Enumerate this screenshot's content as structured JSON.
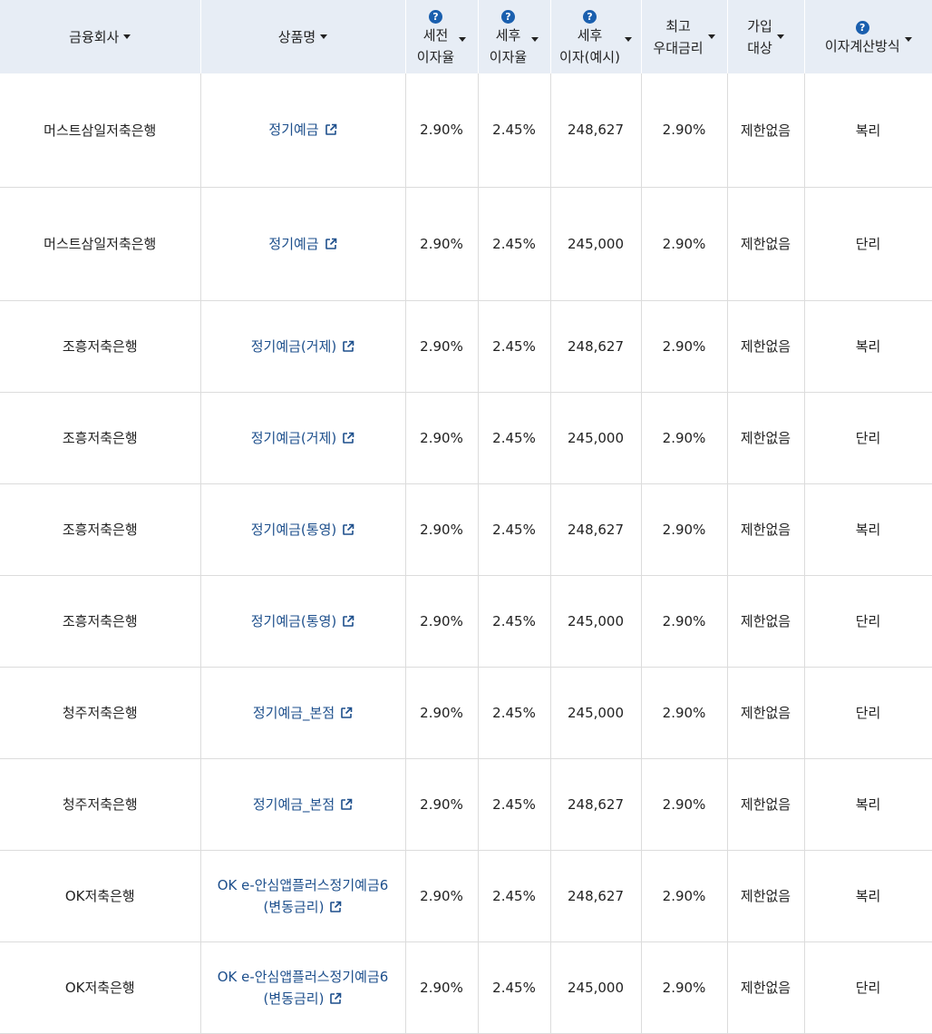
{
  "header": {
    "company": "금융회사",
    "product": "상품명",
    "pre_tax_rate_1": "세전",
    "pre_tax_rate_2": "이자율",
    "after_tax_rate_1": "세후",
    "after_tax_rate_2": "이자율",
    "after_tax_interest_1": "세후",
    "after_tax_interest_2": "이자(예시)",
    "max_rate_1": "최고",
    "max_rate_2": "우대금리",
    "eligibility_1": "가입",
    "eligibility_2": "대상",
    "calc_method": "이자계산방식",
    "help_glyph": "?"
  },
  "rows": [
    {
      "company": "머스트삼일저축은행",
      "product": "정기예금",
      "pre_tax": "2.90%",
      "after_tax": "2.45%",
      "interest": "248,627",
      "max_rate": "2.90%",
      "eligibility": "제한없음",
      "method": "복리"
    },
    {
      "company": "머스트삼일저축은행",
      "product": "정기예금",
      "pre_tax": "2.90%",
      "after_tax": "2.45%",
      "interest": "245,000",
      "max_rate": "2.90%",
      "eligibility": "제한없음",
      "method": "단리"
    },
    {
      "company": "조흥저축은행",
      "product": "정기예금(거제)",
      "pre_tax": "2.90%",
      "after_tax": "2.45%",
      "interest": "248,627",
      "max_rate": "2.90%",
      "eligibility": "제한없음",
      "method": "복리"
    },
    {
      "company": "조흥저축은행",
      "product": "정기예금(거제)",
      "pre_tax": "2.90%",
      "after_tax": "2.45%",
      "interest": "245,000",
      "max_rate": "2.90%",
      "eligibility": "제한없음",
      "method": "단리"
    },
    {
      "company": "조흥저축은행",
      "product": "정기예금(통영)",
      "pre_tax": "2.90%",
      "after_tax": "2.45%",
      "interest": "248,627",
      "max_rate": "2.90%",
      "eligibility": "제한없음",
      "method": "복리"
    },
    {
      "company": "조흥저축은행",
      "product": "정기예금(통영)",
      "pre_tax": "2.90%",
      "after_tax": "2.45%",
      "interest": "245,000",
      "max_rate": "2.90%",
      "eligibility": "제한없음",
      "method": "단리"
    },
    {
      "company": "청주저축은행",
      "product": "정기예금_본점",
      "pre_tax": "2.90%",
      "after_tax": "2.45%",
      "interest": "245,000",
      "max_rate": "2.90%",
      "eligibility": "제한없음",
      "method": "단리"
    },
    {
      "company": "청주저축은행",
      "product": "정기예금_본점",
      "pre_tax": "2.90%",
      "after_tax": "2.45%",
      "interest": "248,627",
      "max_rate": "2.90%",
      "eligibility": "제한없음",
      "method": "복리"
    },
    {
      "company": "OK저축은행",
      "product": "OK e-안심앱플러스정기예금6 (변동금리)",
      "pre_tax": "2.90%",
      "after_tax": "2.45%",
      "interest": "248,627",
      "max_rate": "2.90%",
      "eligibility": "제한없음",
      "method": "복리"
    },
    {
      "company": "OK저축은행",
      "product": "OK e-안심앱플러스정기예금6 (변동금리)",
      "pre_tax": "2.90%",
      "after_tax": "2.45%",
      "interest": "245,000",
      "max_rate": "2.90%",
      "eligibility": "제한없음",
      "method": "단리"
    }
  ],
  "colors": {
    "header_bg": "#e7edf5",
    "link": "#1d4f8c",
    "help_icon": "#1a5fae",
    "border": "#dcdcdc"
  },
  "icons": {
    "help": "question-circle-icon",
    "sort": "caret-down-icon",
    "external": "external-link-icon"
  }
}
